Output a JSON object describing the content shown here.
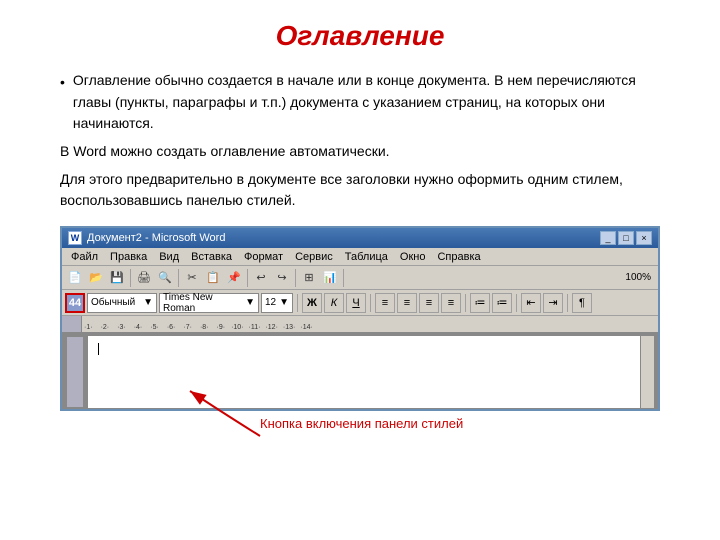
{
  "title": "Оглавление",
  "paragraphs": [
    {
      "id": "para1",
      "bullet": true,
      "text": "Оглавление обычно создается в начале или в конце документа. В нем перечисляются главы (пункты, параграфы и т.п.) документа с указанием страниц, на которых они начинаются."
    },
    {
      "id": "para2",
      "bullet": false,
      "text": "В Word можно создать оглавление автоматически."
    },
    {
      "id": "para3",
      "bullet": false,
      "text": "Для этого предварительно в документе все заголовки нужно оформить одним стилем, воспользовавшись панелью стилей."
    }
  ],
  "word_window": {
    "titlebar": "Документ2 - Microsoft Word",
    "menus": [
      "Файл",
      "Правка",
      "Вид",
      "Вставка",
      "Формат",
      "Сервис",
      "Таблица",
      "Окно",
      "Справка"
    ],
    "style_value": "Обычный",
    "font_value": "Times New Roman",
    "size_value": "12",
    "bold_label": "Ж",
    "italic_label": "К",
    "underline_label": "Ч",
    "zoom_label": "100%"
  },
  "arrow_label": "Кнопка включения панели стилей",
  "colors": {
    "title_red": "#cc0000",
    "arrow_red": "#cc0000",
    "word_blue": "#2a5a9a"
  }
}
